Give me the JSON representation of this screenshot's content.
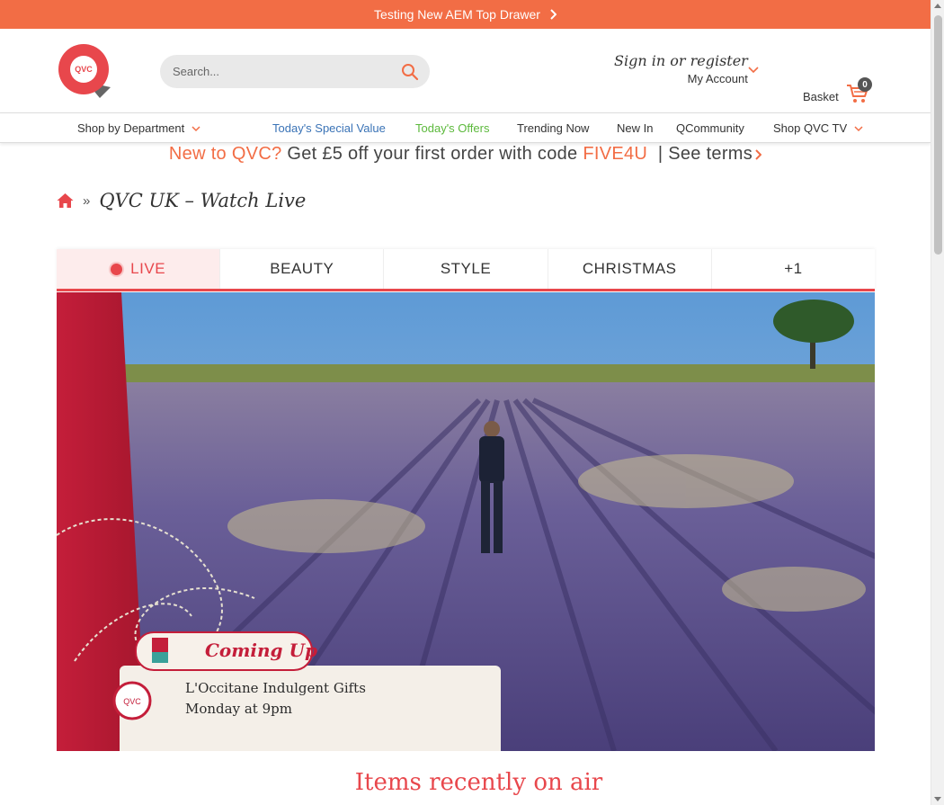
{
  "top_drawer": {
    "text": "Testing New AEM Top Drawer",
    "icon": "chevron-right-icon"
  },
  "header": {
    "logo_text": "QVC",
    "search": {
      "placeholder": "Search..."
    },
    "account": {
      "title": "Sign in or register",
      "subtitle": "My Account"
    },
    "basket": {
      "label": "Basket",
      "count": "0"
    }
  },
  "nav": {
    "shop_by_department": "Shop by Department",
    "special_value": "Today's Special Value",
    "offers": "Today's Offers",
    "trending": "Trending Now",
    "new_in": "New In",
    "qcommunity": "QCommunity",
    "shop_qvc_tv": "Shop QVC TV"
  },
  "promo": {
    "lead": "New to QVC?",
    "middle": "Get £5 off your first order with code",
    "code": "FIVE4U",
    "terms": "| See terms"
  },
  "breadcrumb": {
    "separator": "»",
    "title": "QVC UK – Watch Live"
  },
  "tabs": [
    {
      "label": "LIVE",
      "active": true
    },
    {
      "label": "BEAUTY",
      "active": false
    },
    {
      "label": "STYLE",
      "active": false
    },
    {
      "label": "CHRISTMAS",
      "active": false
    },
    {
      "label": "+1",
      "active": false
    }
  ],
  "video": {
    "coming_up": "Coming Up",
    "show_title": "L'Occitane Indulgent Gifts",
    "show_time": "Monday at 9pm",
    "logo_text": "QVC"
  },
  "recent_heading": "Items recently on air",
  "colors": {
    "brand": "#f26d45",
    "accent_red": "#e8474c",
    "special_blue": "#3a73b6",
    "offers_green": "#5cb93c"
  }
}
